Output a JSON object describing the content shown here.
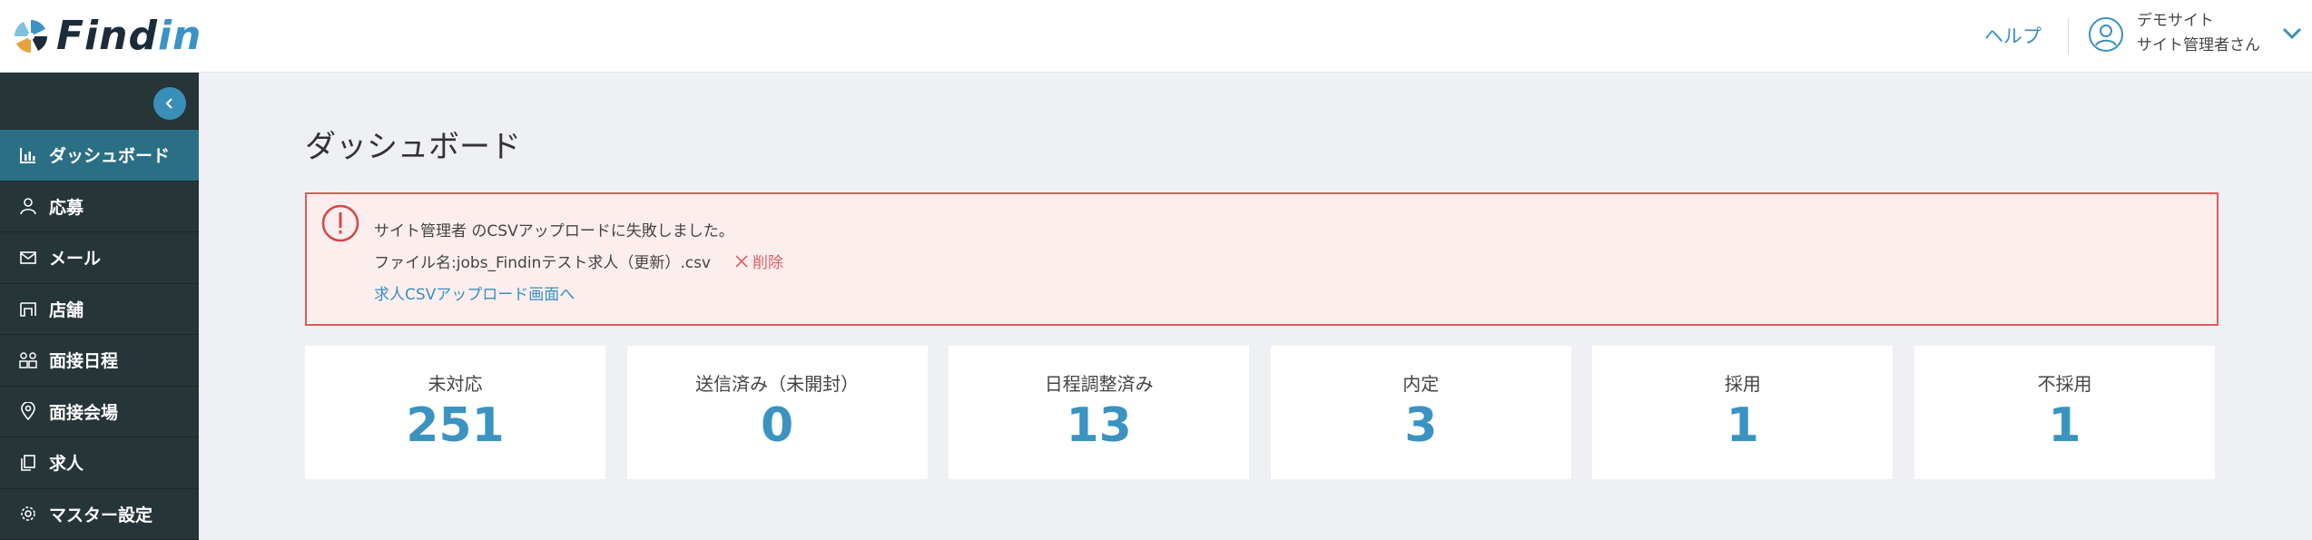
{
  "header": {
    "logo_prefix": "Find",
    "logo_suffix": "in",
    "help_label": "ヘルプ",
    "user_site": "デモサイト",
    "user_name": "サイト管理者さん"
  },
  "sidebar": {
    "items": [
      {
        "label": "ダッシュボード",
        "icon": "bar-chart-icon",
        "active": true
      },
      {
        "label": "応募",
        "icon": "person-icon"
      },
      {
        "label": "メール",
        "icon": "mail-icon"
      },
      {
        "label": "店舗",
        "icon": "store-icon"
      },
      {
        "label": "面接日程",
        "icon": "people-icon"
      },
      {
        "label": "面接会場",
        "icon": "map-pin-icon"
      },
      {
        "label": "求人",
        "icon": "copy-icon"
      },
      {
        "label": "マスター設定",
        "icon": "gear-icon"
      }
    ]
  },
  "main": {
    "title": "ダッシュボード",
    "alert": {
      "message": "サイト管理者 のCSVアップロードに失敗しました。",
      "file_line": "ファイル名:jobs_Findinテスト求人（更新）.csv",
      "delete_label": "削除",
      "link_label": "求人CSVアップロード画面へ"
    },
    "cards": [
      {
        "label": "未対応",
        "value": "251"
      },
      {
        "label": "送信済み（未開封）",
        "value": "0"
      },
      {
        "label": "日程調整済み",
        "value": "13"
      },
      {
        "label": "内定",
        "value": "3"
      },
      {
        "label": "採用",
        "value": "1"
      },
      {
        "label": "不採用",
        "value": "1"
      }
    ]
  },
  "colors": {
    "accent": "#3a93c0",
    "sidebar_bg": "#263537",
    "sidebar_active": "#2b6f85",
    "alert_border": "#e05a5a",
    "alert_bg": "#fdeeee"
  }
}
